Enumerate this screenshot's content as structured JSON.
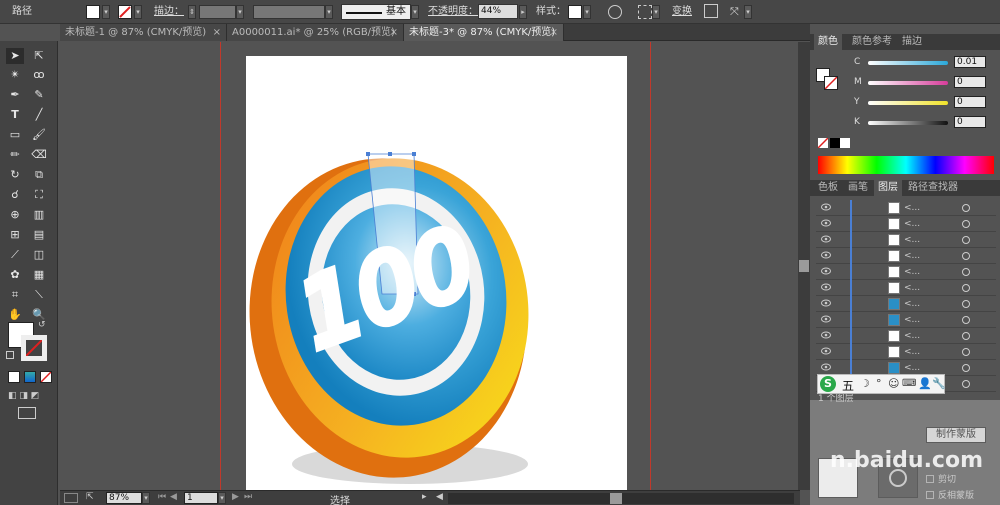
{
  "control_bar": {
    "selection_type": "路径",
    "stroke_label": "描边：",
    "stroke_style": "基本",
    "opacity_label": "不透明度：",
    "opacity_value": "44%",
    "style_label": "样式：",
    "transform_label": "变换"
  },
  "tabs": [
    {
      "label": "未标题-1 @ 87% (CMYK/预览)",
      "close": "×"
    },
    {
      "label": "A0000011.ai* @ 25% (RGB/预览)",
      "close": "×"
    },
    {
      "label": "未标题-3* @ 87% (CMYK/预览)",
      "close": "×"
    }
  ],
  "color_panel": {
    "tabs": [
      "颜色",
      "颜色参考",
      "描边"
    ],
    "channels": [
      {
        "name": "C",
        "value": "0.01",
        "color": "#2aa7d8"
      },
      {
        "name": "M",
        "value": "0",
        "color": "#d63c9a"
      },
      {
        "name": "Y",
        "value": "0",
        "color": "#f0e22a"
      },
      {
        "name": "K",
        "value": "0",
        "color": "#111111"
      }
    ]
  },
  "layers_panel": {
    "tabs": [
      "色板",
      "画笔",
      "图层",
      "路径查找器"
    ],
    "rows": [
      {
        "name": "<...",
        "thumb": "#ffffff"
      },
      {
        "name": "<...",
        "thumb": "#ffffff"
      },
      {
        "name": "<...",
        "thumb": "#ffffff"
      },
      {
        "name": "<...",
        "thumb": "#ffffff"
      },
      {
        "name": "<...",
        "thumb": "#ffffff"
      },
      {
        "name": "<...",
        "thumb": "#ffffff"
      },
      {
        "name": "<...",
        "thumb": "#2a8fc6"
      },
      {
        "name": "<...",
        "thumb": "#2a8fc6"
      },
      {
        "name": "<...",
        "thumb": "#ffffff"
      },
      {
        "name": "<...",
        "thumb": "#ffffff"
      },
      {
        "name": "<...",
        "thumb": "#2a8fc6"
      },
      {
        "name": "<...",
        "thumb": "#f0a020"
      }
    ],
    "count_label": "1 个图层"
  },
  "transparency": {
    "make_mask_button": "制作蒙版",
    "clip_label": "剪切",
    "invert_label": "反相蒙版"
  },
  "ime": {
    "label": "五"
  },
  "watermark_text": "n.baidu.com",
  "status_bar": {
    "zoom": "87%",
    "page": "1",
    "tool": "选择"
  },
  "artwork": {
    "text": "100",
    "colors": {
      "orange": "#ef8a1a",
      "yellow": "#f7d81a",
      "blue": "#1c8fc8",
      "light_blue": "#9fd3ee",
      "shadow": "#d6d6d6"
    }
  }
}
